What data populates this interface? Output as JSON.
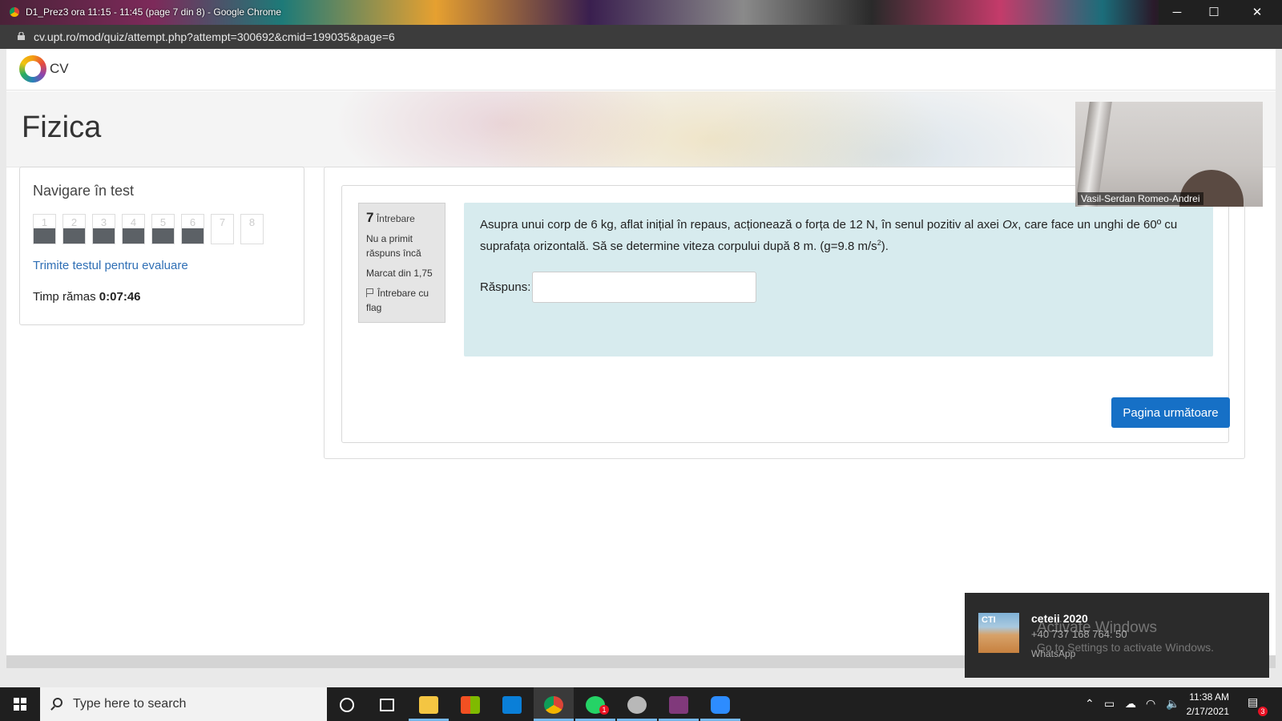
{
  "browser": {
    "window_title": "D1_Prez3 ora 11:15 - 11:45 (page 7 din 8) - Google Chrome",
    "url": "cv.upt.ro/mod/quiz/attempt.php?attempt=300692&cmid=199035&page=6",
    "controls": {
      "minimize": "─",
      "maximize": "☐",
      "close": "✕"
    }
  },
  "site": {
    "logo_text": "CV",
    "course_title": "Fizica"
  },
  "quiz_nav": {
    "heading": "Navigare în test",
    "questions": [
      {
        "label": "1",
        "answered": true
      },
      {
        "label": "2",
        "answered": true
      },
      {
        "label": "3",
        "answered": true
      },
      {
        "label": "4",
        "answered": true
      },
      {
        "label": "5",
        "answered": true
      },
      {
        "label": "6",
        "answered": true
      },
      {
        "label": "7",
        "answered": false
      },
      {
        "label": "8",
        "answered": false
      }
    ],
    "submit_link": "Trimite testul pentru evaluare",
    "time_label": "Timp rămas",
    "time_value": "0:07:46"
  },
  "question": {
    "number": "7",
    "number_label": "Întrebare",
    "status": "Nu a primit răspuns încă",
    "mark": "Marcat din 1,75",
    "flag_label": "Întrebare cu flag",
    "text_part1": "Asupra unui corp de 6 kg, aflat inițial în repaus, acționează o forța de 12 N, în senul pozitiv al axei ",
    "text_axis": "Ox",
    "text_part2": ", care face un unghi de 60º cu suprafața orizontală. Să se determine viteza corpului după 8 m. (g=9.8 m/s",
    "text_sup": "2",
    "text_end": ").",
    "answer_label": "Răspuns:",
    "answer_value": "",
    "next_button": "Pagina următoare"
  },
  "video": {
    "participant_name": "Vasil-Serdan Romeo-Andrei"
  },
  "notification": {
    "thumb_text": "CTI",
    "title": "ceteii 2020",
    "message": "+40 737 168 764: 50",
    "app": "WhatsApp"
  },
  "watermark": {
    "line1": "Activate Windows",
    "line2": "Go to Settings to activate Windows."
  },
  "taskbar": {
    "search_placeholder": "Type here to search",
    "whatsapp_badge": "1",
    "notifications_badge": "3",
    "time": "11:38 AM",
    "date": "2/17/2021"
  }
}
